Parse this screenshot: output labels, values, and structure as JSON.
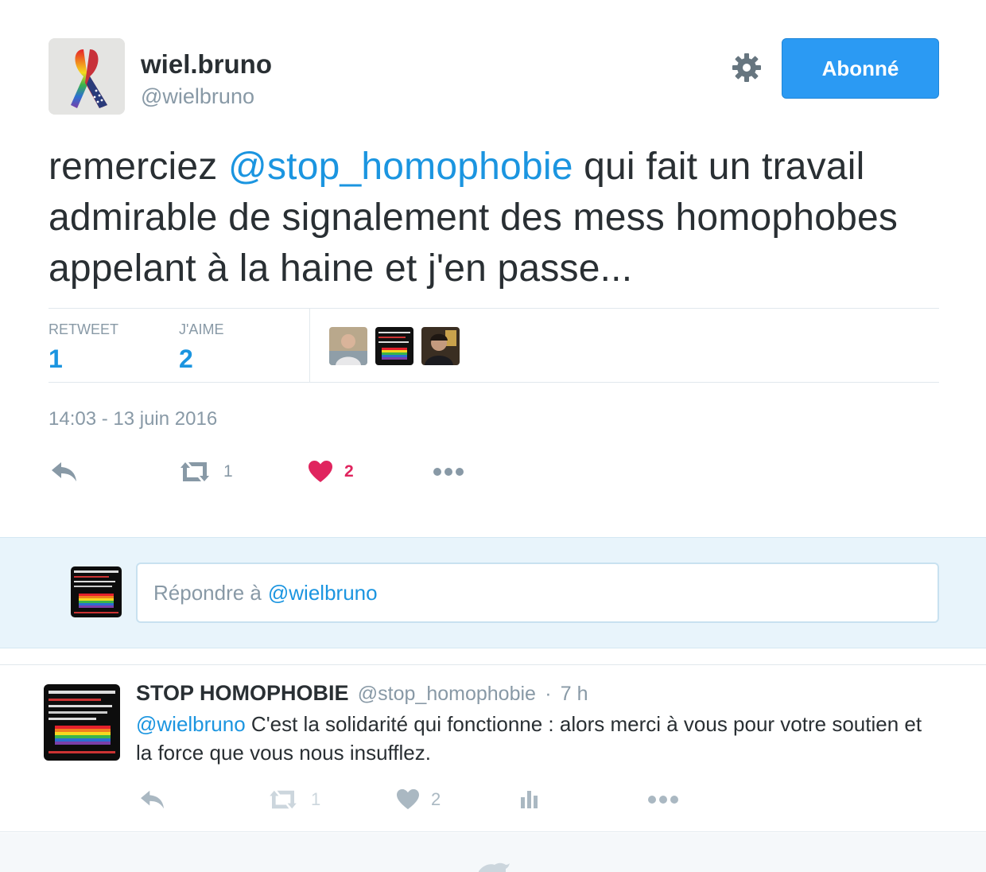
{
  "colors": {
    "accent": "#1b95e0",
    "button_bg": "#2b9af3",
    "like_red": "#e0245e",
    "muted": "#8899a6",
    "faint": "#ccd6dd",
    "reply_bg": "#e8f4fb"
  },
  "tweet": {
    "author_name": "wiel.bruno",
    "author_handle": "@wielbruno",
    "avatar_icon": "ribbon-icon",
    "settings_icon": "gear-icon",
    "follow_label": "Abonné",
    "text_before": "remerciez ",
    "text_mention": "@stop_homophobie",
    "text_after": " qui fait un travail admirable de signalement des mess homophobes appelant à la haine et j'en passe...",
    "stats": {
      "retweet_label": "RETWEET",
      "retweet_count": "1",
      "like_label": "J'AIME",
      "like_count": "2"
    },
    "timestamp": "14:03 - 13 juin 2016",
    "actions": {
      "reply_icon": "reply-icon",
      "retweet_icon": "retweet-icon",
      "retweet_count": "1",
      "like_icon": "heart-icon",
      "like_count": "2",
      "more_icon": "more-icon"
    }
  },
  "reply_box": {
    "placeholder_prefix": "Répondre à",
    "placeholder_handle": "@wielbruno"
  },
  "reply_tweet": {
    "author_name": "STOP HOMOPHOBIE",
    "author_handle": "@stop_homophobie",
    "separator": "·",
    "time": "7 h",
    "mention": "@wielbruno",
    "text": " C'est la solidarité qui fonctionne : alors merci à vous pour votre soutien et la force que vous nous insufflez.",
    "actions": {
      "retweet_count": "1",
      "like_count": "2"
    }
  },
  "footer": {
    "icon": "bird-icon"
  }
}
